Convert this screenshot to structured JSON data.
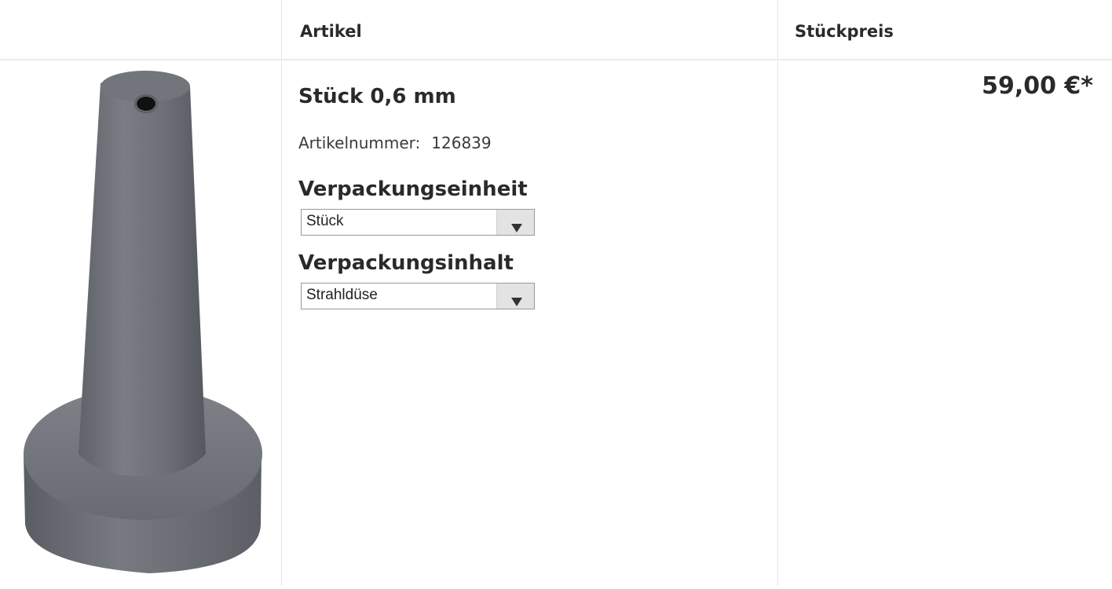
{
  "header": {
    "col_article": "Artikel",
    "col_price": "Stückpreis"
  },
  "product": {
    "image_icon": "nozzle-product-image",
    "title": "Stück 0,6 mm",
    "article_number_label": "Artikelnummer:",
    "article_number": "126839",
    "packaging_unit_label": "Verpackungseinheit",
    "packaging_unit_value": "Stück",
    "packaging_content_label": "Verpackungsinhalt",
    "packaging_content_value": "Strahldüse",
    "price": "59,00 €*"
  },
  "colors": {
    "divider": "#e6e6e6",
    "text": "#2a2a2a",
    "nozzle": "#6e7178"
  }
}
